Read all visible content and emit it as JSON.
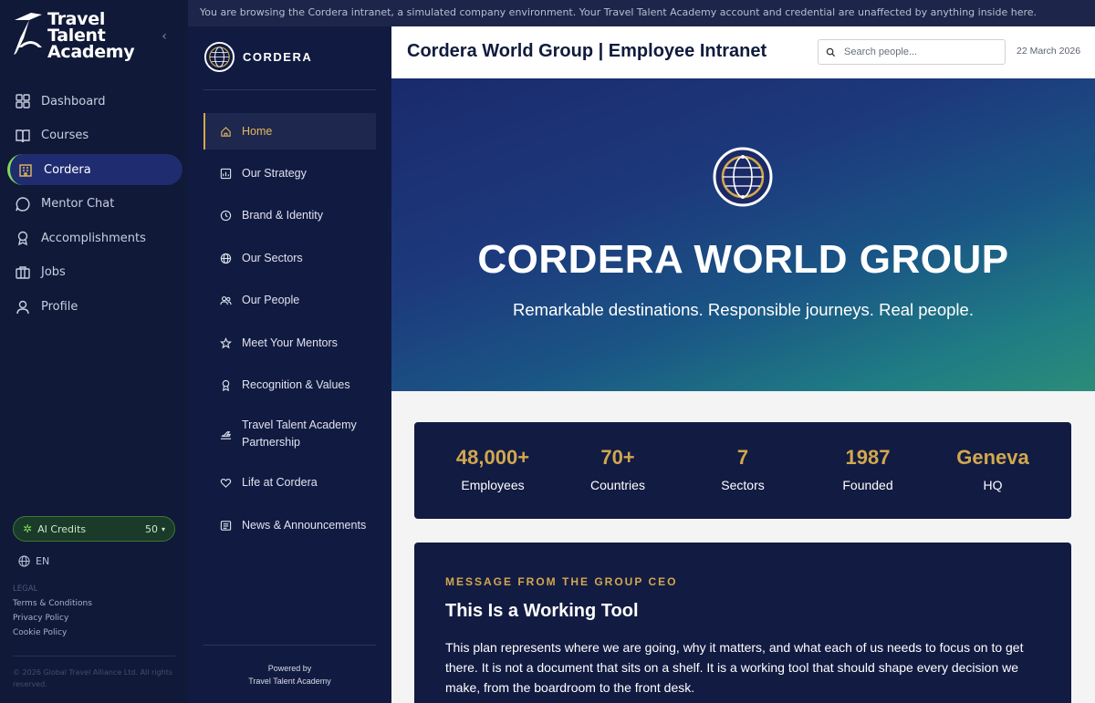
{
  "app": {
    "logo_text": [
      "Travel",
      "Talent",
      "Academy"
    ],
    "nav": [
      {
        "label": "Dashboard",
        "icon": "dashboard-icon"
      },
      {
        "label": "Courses",
        "icon": "book-icon"
      },
      {
        "label": "Cordera",
        "icon": "building-icon",
        "active": true
      },
      {
        "label": "Mentor Chat",
        "icon": "chat-icon"
      },
      {
        "label": "Accomplishments",
        "icon": "award-icon"
      },
      {
        "label": "Jobs",
        "icon": "briefcase-icon"
      },
      {
        "label": "Profile",
        "icon": "user-icon"
      }
    ],
    "credits": {
      "label": "AI Credits",
      "value": "50"
    },
    "language": "EN",
    "legal": {
      "heading": "LEGAL",
      "links": [
        "Terms & Conditions",
        "Privacy Policy",
        "Cookie Policy"
      ]
    },
    "copyright": "© 2026 Global Travel Alliance Ltd. All rights reserved."
  },
  "banner": "You are browsing the Cordera intranet, a simulated company environment. Your Travel Talent Academy account and credential are unaffected by anything inside here.",
  "intranet": {
    "brand": "CORDERA",
    "nav": [
      {
        "label": "Home",
        "icon": "home-icon",
        "active": true
      },
      {
        "label": "Our Strategy",
        "icon": "chart-icon"
      },
      {
        "label": "Brand & Identity",
        "icon": "clock-icon"
      },
      {
        "label": "Our Sectors",
        "icon": "globe-icon"
      },
      {
        "label": "Our People",
        "icon": "people-icon"
      },
      {
        "label": "Meet Your Mentors",
        "icon": "star-icon"
      },
      {
        "label": "Recognition & Values",
        "icon": "ribbon-icon"
      },
      {
        "label": "Travel Talent Academy Partnership",
        "icon": "plane-icon"
      },
      {
        "label": "Life at Cordera",
        "icon": "heart-icon"
      },
      {
        "label": "News & Announcements",
        "icon": "news-icon"
      }
    ],
    "powered_by": "Powered by",
    "powered_name": "Travel Talent Academy"
  },
  "main": {
    "title": "Cordera World Group | Employee Intranet",
    "search_placeholder": "Search people...",
    "date": "22 March 2026",
    "hero": {
      "title": "CORDERA WORLD GROUP",
      "tagline": "Remarkable destinations. Responsible journeys. Real people."
    },
    "stats": [
      {
        "value": "48,000+",
        "label": "Employees"
      },
      {
        "value": "70+",
        "label": "Countries"
      },
      {
        "value": "7",
        "label": "Sectors"
      },
      {
        "value": "1987",
        "label": "Founded"
      },
      {
        "value": "Geneva",
        "label": "HQ"
      }
    ],
    "ceo": {
      "eyebrow": "MESSAGE FROM THE GROUP CEO",
      "title": "This Is a Working Tool",
      "body": "This plan represents where we are going, why it matters, and what each of us needs to focus on to get there. It is not a document that sits on a shelf. It is a working tool that should shape every decision we make, from the boardroom to the front desk."
    }
  },
  "colors": {
    "accent_gold": "#d2a74e",
    "accent_green": "#7fdc5a",
    "navy": "#121b42"
  }
}
